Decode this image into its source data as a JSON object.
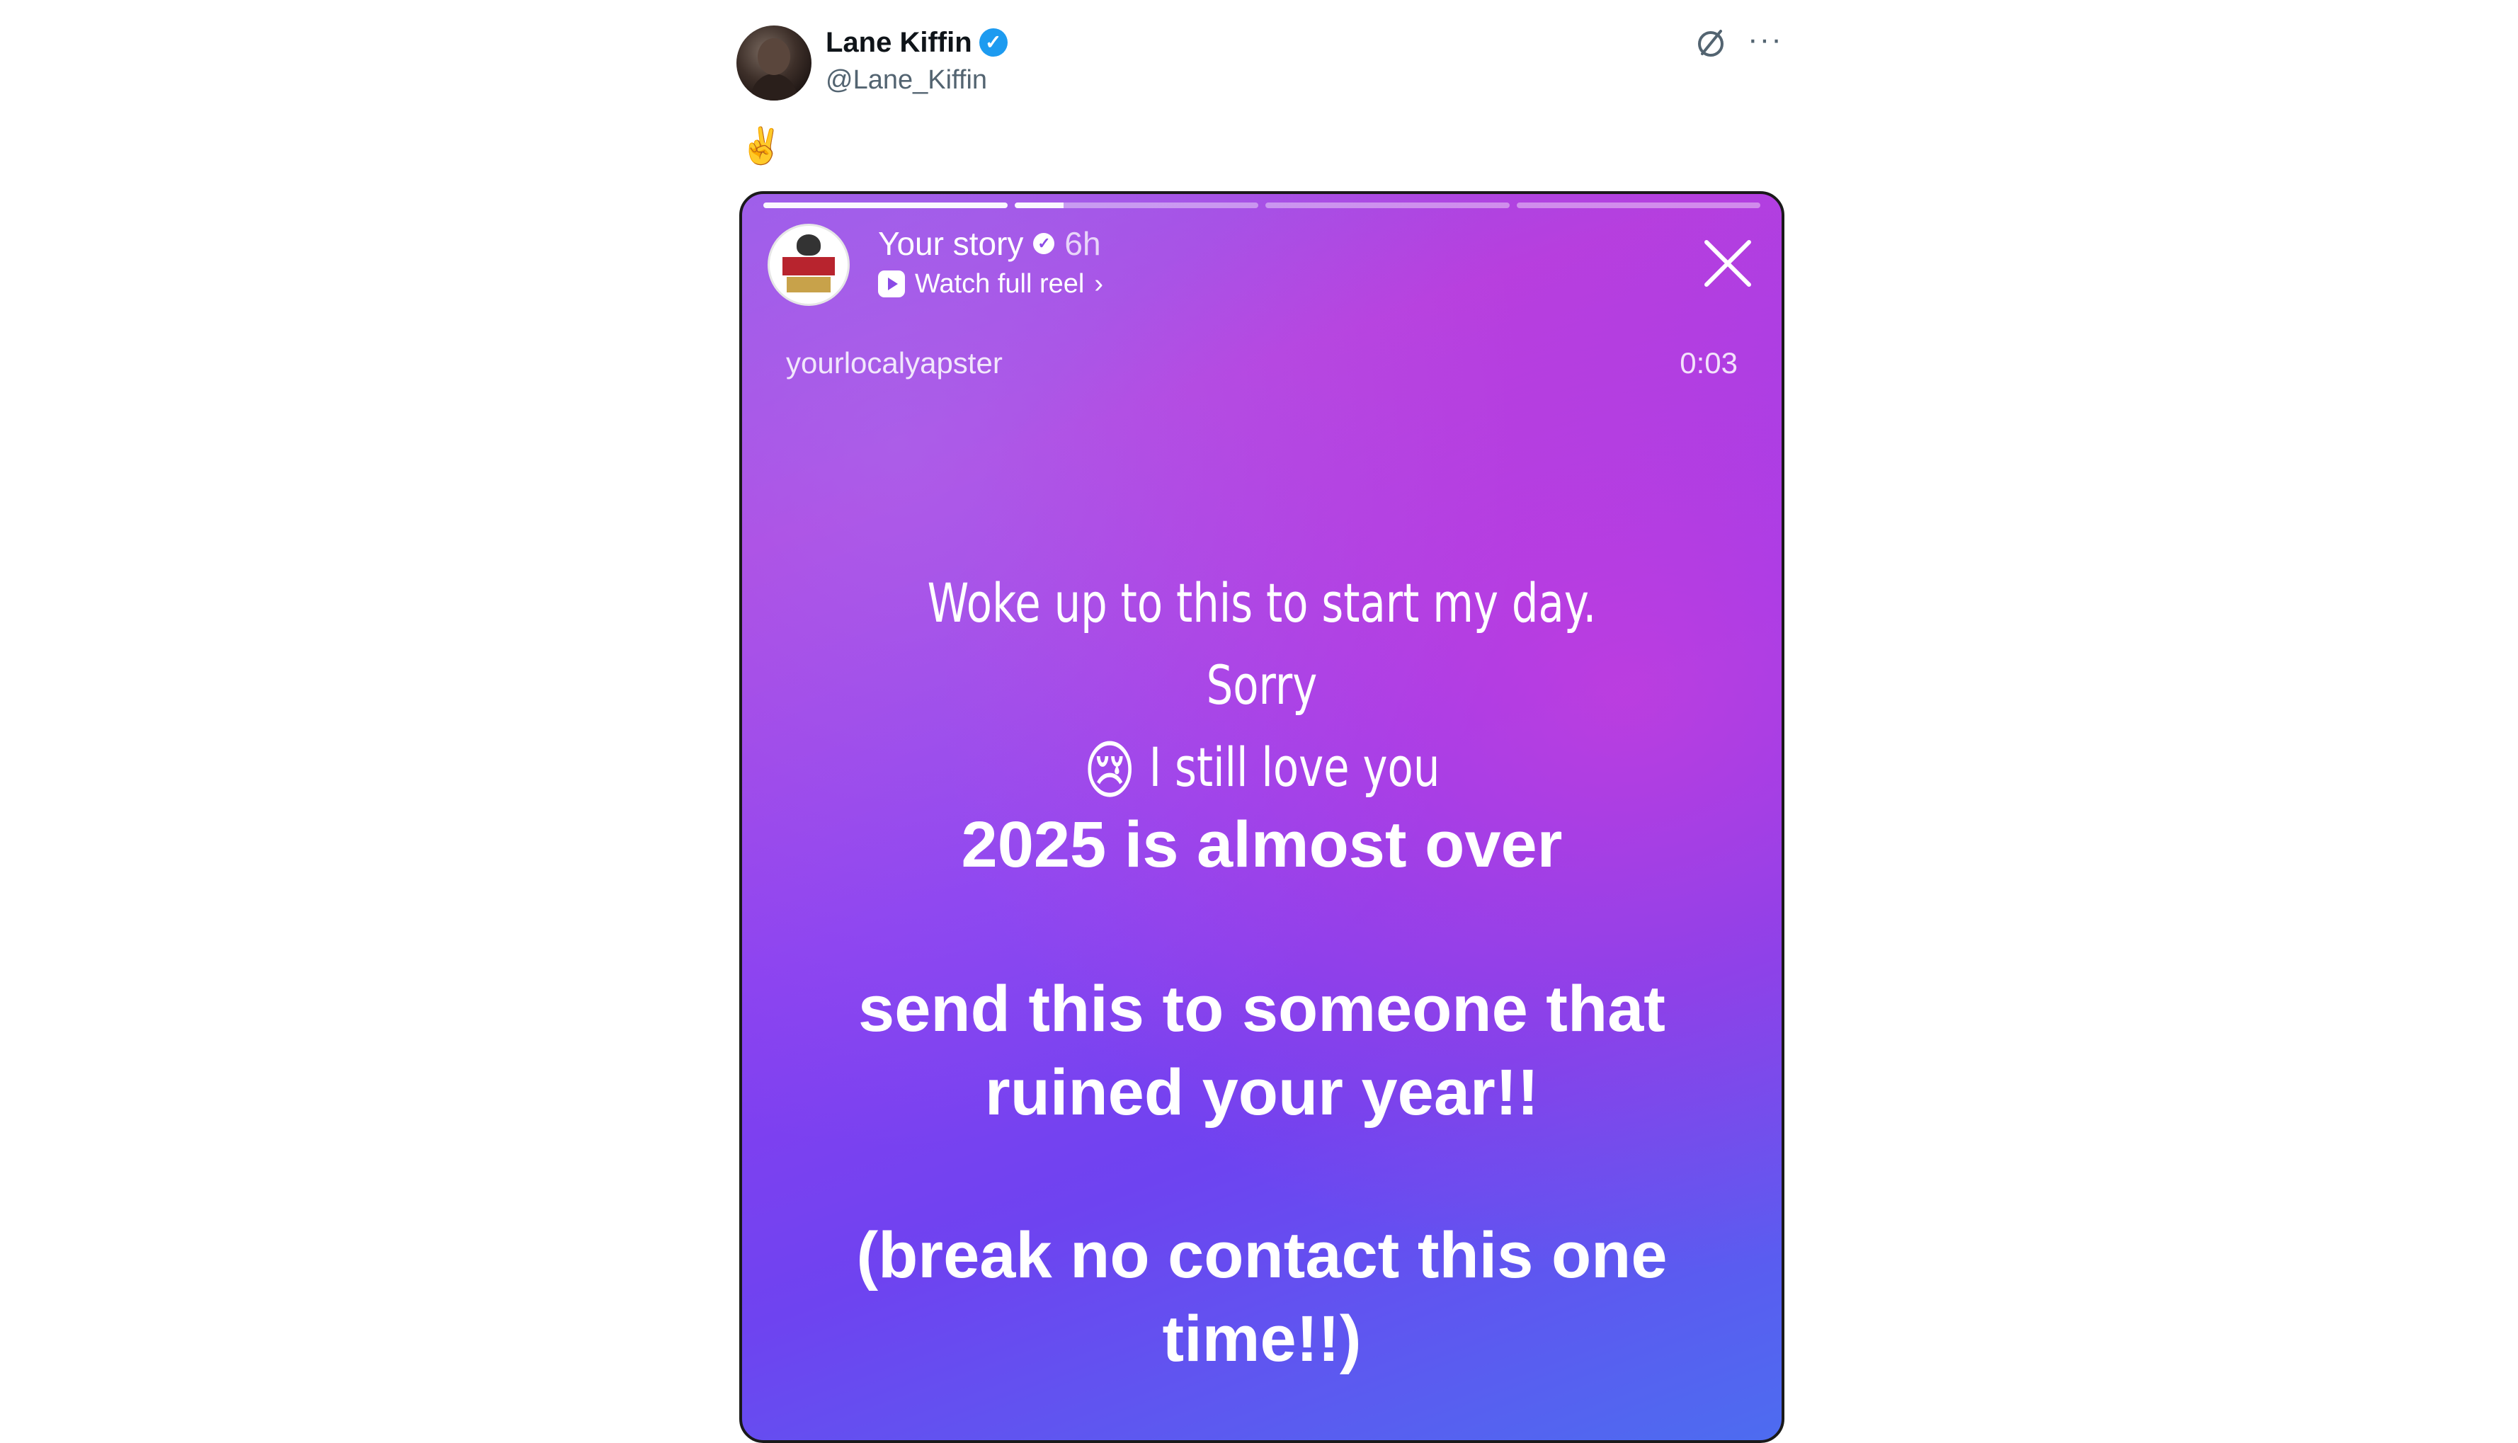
{
  "tweet": {
    "author_name": "Lane Kiffin",
    "author_handle": "@Lane_Kiffin",
    "text": "✌️"
  },
  "story": {
    "title": "Your story",
    "age": "6h",
    "watch_label": "Watch full reel",
    "username": "yourlocalyapster",
    "timer": "0:03",
    "caption_line1": "Woke up to this to start my day. Sorry",
    "caption_emoji": "😢",
    "caption_line2": "I still love you",
    "message_1": "2025 is almost over",
    "message_2": "send this to someone that ruined your year!!",
    "message_3": "(break no contact this one time!!)"
  },
  "icons": {
    "verified": "verified-badge-icon",
    "grok": "grok-icon",
    "more": "more-options-icon",
    "close": "close-icon",
    "play": "play-icon"
  },
  "colors": {
    "verified_blue": "#1d9bf0",
    "story_purple": "#8a3ef0",
    "story_magenta": "#b03fe0",
    "story_blue": "#4d6cf0"
  }
}
